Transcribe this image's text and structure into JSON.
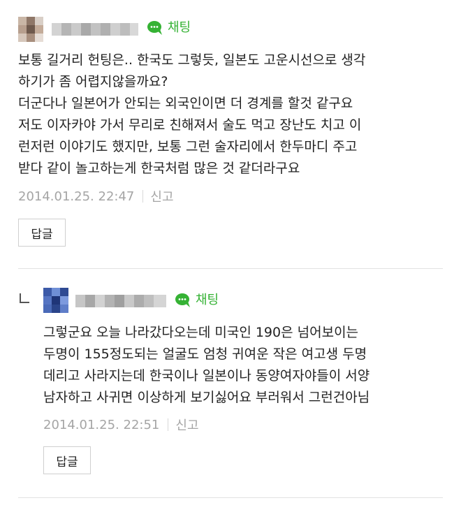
{
  "comments": [
    {
      "chat_label": "채팅",
      "icon": "chat-bubble-icon",
      "accent_color": "#35b234",
      "lines": [
        "보통 길거리 헌팅은.. 한국도 그렇듯, 일본도 고운시선으로 생각",
        "하기가 좀 어렵지않을까요?",
        "더군다나 일본어가 안되는 외국인이면 더 경계를 할것 같구요",
        "저도 이자카야 가서 무리로 친해져서 술도 먹고 장난도 치고 이",
        "런저런 이야기도 했지만, 보통 그런 술자리에서 한두마디 주고",
        "받다 같이 놀고하는게 한국처럼 많은 것 같더라구요"
      ],
      "date": "2014.01.25. 22:47",
      "report_label": "신고",
      "reply_label": "답글"
    },
    {
      "chat_label": "채팅",
      "icon": "chat-bubble-icon",
      "accent_color": "#35b234",
      "lines": [
        "그렇군요 오늘 나라갔다오는데 미국인 190은 넘어보이는",
        "두명이 155정도되는 얼굴도 엄청 귀여운 작은 여고생 두명",
        "데리고 사라지는데 한국이나 일본이나 동양여자야들이 서양",
        "남자하고 사귀면 이상하게 보기싫어요 부러워서 그런건아님"
      ],
      "date": "2014.01.25. 22:51",
      "report_label": "신고",
      "reply_label": "답글"
    }
  ]
}
